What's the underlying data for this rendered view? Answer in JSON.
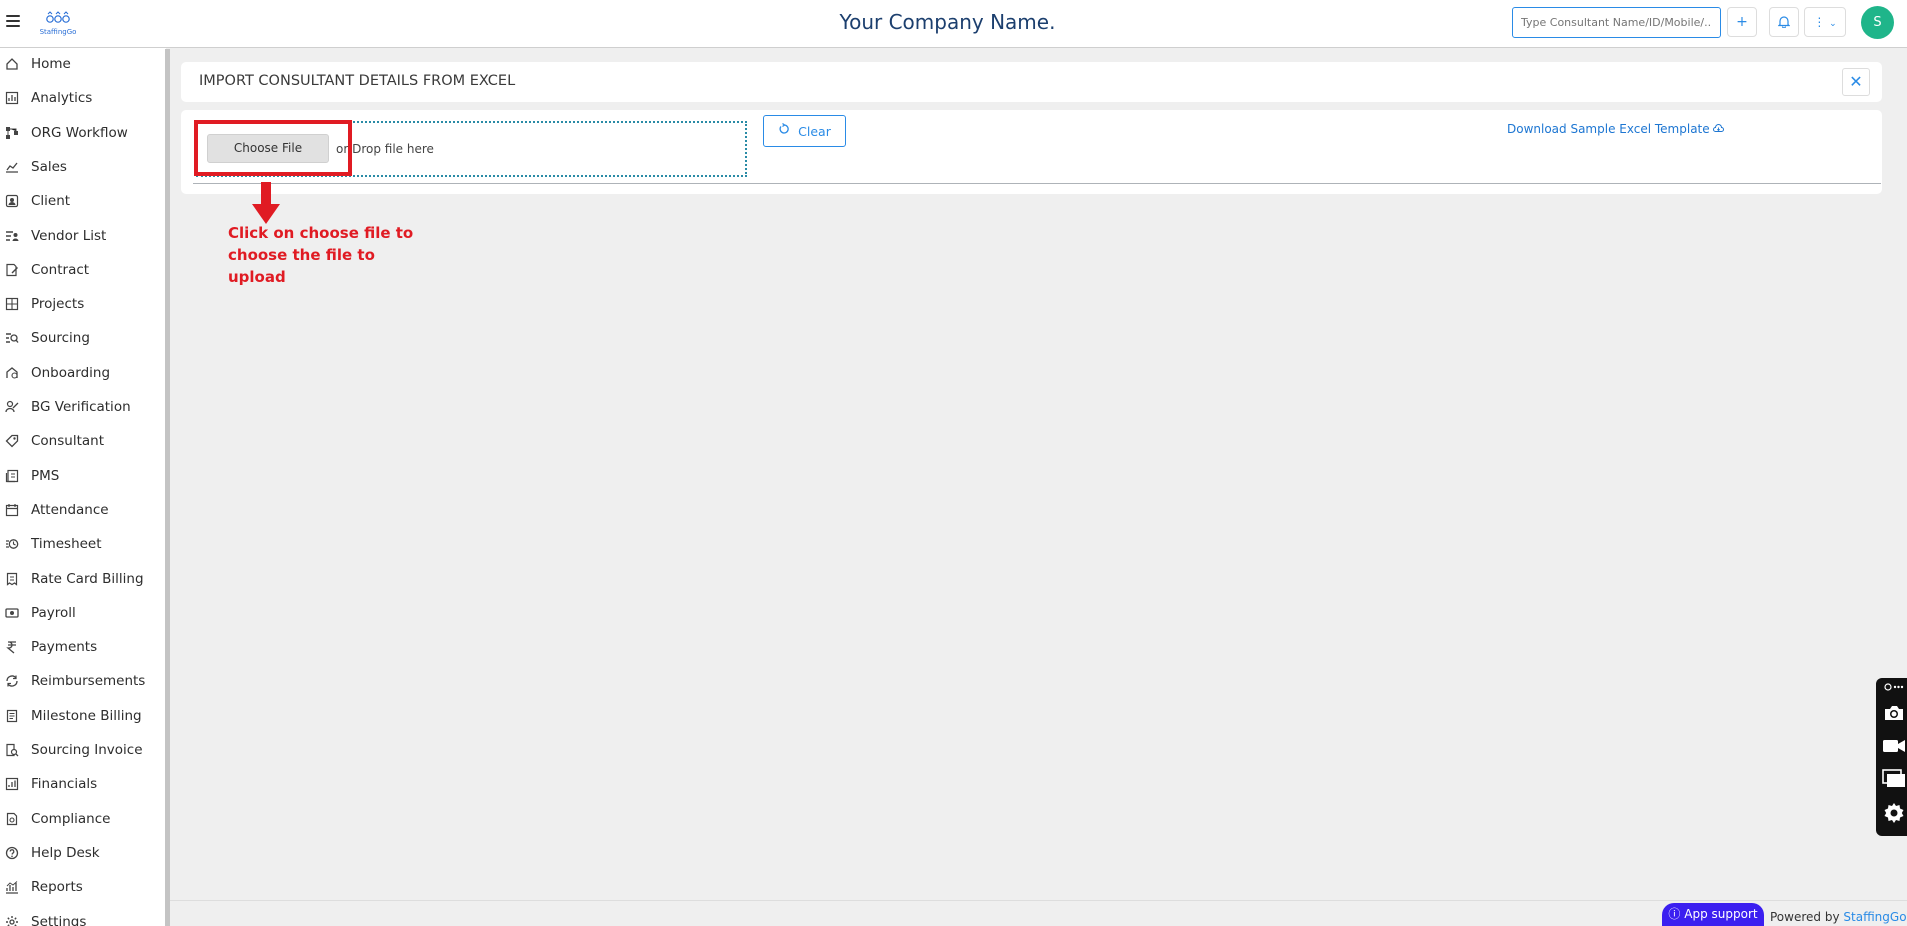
{
  "header": {
    "logo_text": "StaffingGo",
    "company_name": "Your Company Name.",
    "search_placeholder": "Type Consultant Name/ID/Mobile/...",
    "add_label": "+",
    "avatar_initial": "S"
  },
  "sidebar": {
    "items": [
      {
        "label": "Home",
        "icon": "home-icon"
      },
      {
        "label": "Analytics",
        "icon": "analytics-icon"
      },
      {
        "label": "ORG Workflow",
        "icon": "workflow-icon"
      },
      {
        "label": "Sales",
        "icon": "sales-icon"
      },
      {
        "label": "Client",
        "icon": "client-icon"
      },
      {
        "label": "Vendor List",
        "icon": "vendor-icon"
      },
      {
        "label": "Contract",
        "icon": "contract-icon"
      },
      {
        "label": "Projects",
        "icon": "projects-icon"
      },
      {
        "label": "Sourcing",
        "icon": "sourcing-icon"
      },
      {
        "label": "Onboarding",
        "icon": "onboarding-icon"
      },
      {
        "label": "BG Verification",
        "icon": "verification-icon"
      },
      {
        "label": "Consultant",
        "icon": "consultant-icon"
      },
      {
        "label": "PMS",
        "icon": "pms-icon"
      },
      {
        "label": "Attendance",
        "icon": "calendar-icon"
      },
      {
        "label": "Timesheet",
        "icon": "clock-icon"
      },
      {
        "label": "Rate Card Billing",
        "icon": "billing-icon"
      },
      {
        "label": "Payroll",
        "icon": "payroll-icon"
      },
      {
        "label": "Payments",
        "icon": "rupee-icon"
      },
      {
        "label": "Reimbursements",
        "icon": "reimbursement-icon"
      },
      {
        "label": "Milestone Billing",
        "icon": "milestone-icon"
      },
      {
        "label": "Sourcing Invoice",
        "icon": "invoice-icon"
      },
      {
        "label": "Financials",
        "icon": "financials-icon"
      },
      {
        "label": "Compliance",
        "icon": "compliance-icon"
      },
      {
        "label": "Help Desk",
        "icon": "help-icon"
      },
      {
        "label": "Reports",
        "icon": "reports-icon"
      },
      {
        "label": "Settings",
        "icon": "settings-icon"
      }
    ]
  },
  "import": {
    "title": "IMPORT CONSULTANT DETAILS FROM EXCEL",
    "close_label": "✕",
    "choose_file_label": "Choose File",
    "drop_text": "or Drop file here",
    "clear_label": "Clear",
    "download_label": "Download Sample Excel Template"
  },
  "annotation": {
    "text": "Click on choose file to choose the file to upload",
    "color": "#e01b23"
  },
  "footer": {
    "app_support_label": "App support",
    "powered_by": "Powered by",
    "brand": "StaffingGo"
  },
  "colors": {
    "accent": "#2a8be6",
    "avatar": "#1fb58a",
    "support": "#3b1ff0"
  }
}
